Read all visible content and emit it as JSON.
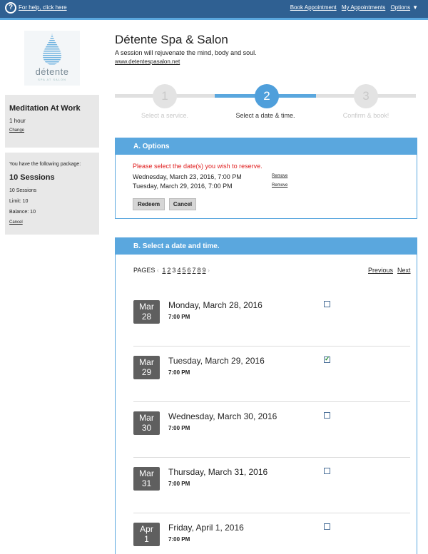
{
  "topbar": {
    "help_icon": "question-circle-icon",
    "help_link": "For help, click here",
    "book": "Book Appointment",
    "my_appointments": "My Appointments",
    "options": "Options",
    "caret": "▼"
  },
  "logo": {
    "word": "détente",
    "sub": "SPA AT SALON"
  },
  "service": {
    "title": "Meditation At Work",
    "duration": "1 hour",
    "change": "Change"
  },
  "package": {
    "intro": "You have the following package:",
    "name": "10 Sessions",
    "sessions": "10 Sessions",
    "limit": "Limit: 10",
    "balance": "Balance: 10",
    "cancel": "Cancel"
  },
  "business": {
    "name": "Détente Spa & Salon",
    "tagline": "A session will rejuvenate the mind, body and soul.",
    "url": "www.detentespasalon.net"
  },
  "steps": [
    {
      "num": "1",
      "label": "Select a service.",
      "active": false
    },
    {
      "num": "2",
      "label": "Select a date & time.",
      "active": true
    },
    {
      "num": "3",
      "label": "Confirm & book!",
      "active": false
    }
  ],
  "options": {
    "header": "A. Options",
    "warning": "Please select the date(s) you wish to reserve.",
    "dates": [
      {
        "text": "Wednesday, March 23, 2016, 7:00 PM",
        "remove": "Remove"
      },
      {
        "text": "Tuesday, March 29, 2016, 7:00 PM",
        "remove": "Remove"
      }
    ],
    "redeem": "Redeem",
    "cancel": "Cancel"
  },
  "schedule": {
    "header": "B. Select a date and time.",
    "pages_label": "PAGES",
    "prev_arrow": "‹",
    "next_arrow": "›",
    "pages": [
      "1",
      "2",
      "3",
      "4",
      "5",
      "6",
      "7",
      "8",
      "9"
    ],
    "current_page": "3",
    "previous": "Previous",
    "next": "Next",
    "rows": [
      {
        "month": "Mar",
        "day": "28",
        "date": "Monday, March 28, 2016",
        "time": "7:00 PM",
        "checked": false
      },
      {
        "month": "Mar",
        "day": "29",
        "date": "Tuesday, March 29, 2016",
        "time": "7:00 PM",
        "checked": true
      },
      {
        "month": "Mar",
        "day": "30",
        "date": "Wednesday, March 30, 2016",
        "time": "7:00 PM",
        "checked": false
      },
      {
        "month": "Mar",
        "day": "31",
        "date": "Thursday, March 31, 2016",
        "time": "7:00 PM",
        "checked": false
      },
      {
        "month": "Apr",
        "day": "1",
        "date": "Friday, April 1, 2016",
        "time": "7:00 PM",
        "checked": false
      }
    ]
  }
}
